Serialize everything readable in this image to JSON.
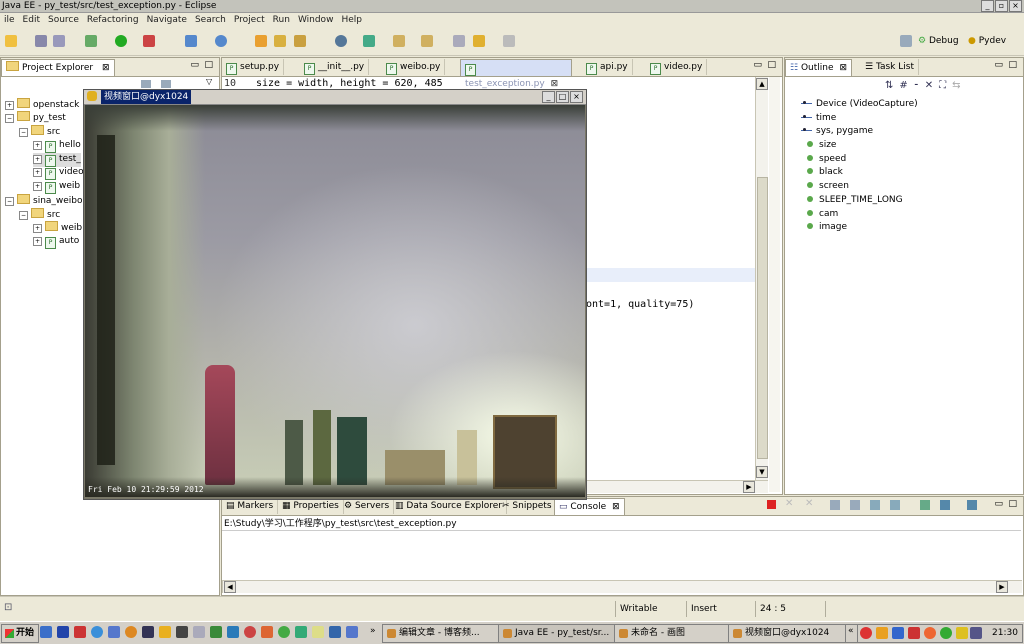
{
  "window": {
    "title": "Java EE - py_test/src/test_exception.py - Eclipse"
  },
  "menu": [
    "ile",
    "Edit",
    "Source",
    "Refactoring",
    "Navigate",
    "Search",
    "Project",
    "Run",
    "Window",
    "Help"
  ],
  "perspectives": {
    "debug": "Debug",
    "pydev": "Pydev"
  },
  "project_explorer": {
    "tab": "Project Explorer",
    "tree": [
      {
        "label": "openstack",
        "kind": "project",
        "expander": "+"
      },
      {
        "label": "py_test",
        "kind": "project",
        "expander": "−"
      },
      {
        "label": "src",
        "kind": "folder",
        "expander": "−"
      },
      {
        "label": "hello",
        "kind": "file",
        "expander": "+"
      },
      {
        "label": "test_",
        "kind": "file",
        "expander": "+"
      },
      {
        "label": "video",
        "kind": "file",
        "expander": "+"
      },
      {
        "label": "weib",
        "kind": "file",
        "expander": "+"
      },
      {
        "label": "sina_weibo",
        "kind": "project",
        "expander": "−"
      },
      {
        "label": "src",
        "kind": "folder",
        "expander": "−"
      },
      {
        "label": "weib",
        "kind": "folder",
        "expander": "+"
      },
      {
        "label": "auto",
        "kind": "file",
        "expander": "+"
      }
    ]
  },
  "editor": {
    "tabs": [
      "setup.py",
      "__init__.py",
      "weibo.py",
      "test_exception.py",
      "api.py",
      "video.py"
    ],
    "active_tab": 3,
    "line10_number": "10",
    "line10_code": "size = width, height = 620, 485",
    "partial_code": "ont=1, quality=75)"
  },
  "outline": {
    "tab": "Outline",
    "tab2": "Task List",
    "items": [
      {
        "label": "Device (VideoCapture)",
        "icon": "import-icon"
      },
      {
        "label": "time",
        "icon": "import-icon"
      },
      {
        "label": "sys, pygame",
        "icon": "import-icon"
      },
      {
        "label": "size",
        "icon": "variable-icon"
      },
      {
        "label": "speed",
        "icon": "variable-icon"
      },
      {
        "label": "black",
        "icon": "variable-icon"
      },
      {
        "label": "screen",
        "icon": "variable-icon"
      },
      {
        "label": "SLEEP_TIME_LONG",
        "icon": "variable-icon"
      },
      {
        "label": "cam",
        "icon": "variable-icon"
      },
      {
        "label": "image",
        "icon": "variable-icon"
      }
    ]
  },
  "camera_window": {
    "title": "视频窗口@dyx1024",
    "timestamp": "Fri Feb 10 21:29:59 2012"
  },
  "bottom_panel": {
    "tabs": [
      "Markers",
      "Properties",
      "Servers",
      "Data Source Explorer",
      "Snippets",
      "Console"
    ],
    "active_tab": 5,
    "console_path": "E:\\Study\\学习\\工作程序\\py_test\\src\\test_exception.py"
  },
  "status": {
    "writable": "Writable",
    "insert": "Insert",
    "position": "24 : 5"
  },
  "taskbar": {
    "start": "开始",
    "tasks": [
      "编辑文章 - 博客频...",
      "Java EE - py_test/sr...",
      "未命名 - 画图",
      "视频窗口@dyx1024"
    ],
    "clock": "21:30"
  },
  "colors": {
    "accent": "#316ac5",
    "tab_highlight": "#d6dff5",
    "camera_bg": "#9c9ba4"
  }
}
